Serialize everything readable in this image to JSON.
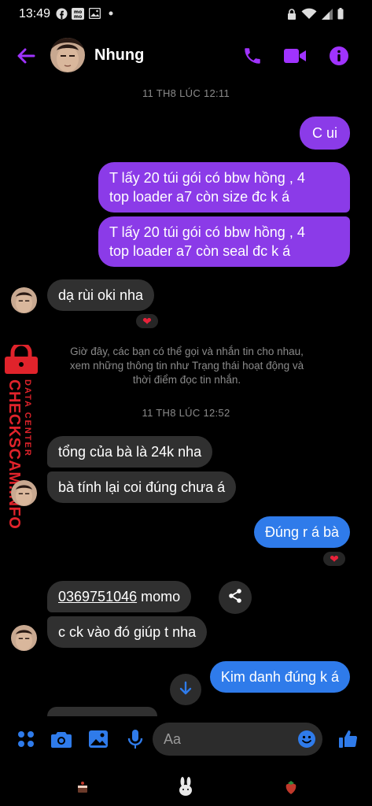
{
  "status_bar": {
    "time": "13:49",
    "left_icons": [
      "facebook-icon",
      "momo-icon",
      "gallery-icon",
      "dot"
    ],
    "right_icons": [
      "lock-icon",
      "wifi-icon",
      "signal-icon",
      "battery-icon"
    ]
  },
  "header": {
    "contact_name": "Nhung",
    "accent_color": "#a033ff"
  },
  "conversation": {
    "timestamp_1": "11 TH8 LÚC 12:11",
    "msg_1": "C ui",
    "msg_2_line1": "T lấy 20 túi gói có bbw hồng , 4",
    "msg_2_line2": "top loader a7 còn size đc k á",
    "msg_3_line1": "T lấy 20 túi gói có bbw hồng , 4",
    "msg_3_line2": "top loader a7 còn seal đc k á",
    "msg_4": "dạ rùi oki nha",
    "system_line1": "Giờ đây, các bạn có thể gọi và nhắn tin cho nhau,",
    "system_line2": "xem những thông tin như Trạng thái hoạt động và",
    "system_line3": "thời điểm đọc tin nhắn.",
    "timestamp_2": "11 TH8 LÚC 12:52",
    "msg_5": "tổng của bà là 24k nha",
    "msg_6": "bà tính lại coi đúng chưa á",
    "msg_7": "Đúng r á bà",
    "msg_8_phone": "0369751046",
    "msg_8_suffix": " momo",
    "msg_9": "c ck vào đó giúp t nha",
    "msg_10": "Kim danh đúng k á",
    "reaction": "❤"
  },
  "watermark": {
    "line1": "DATA CENTER",
    "line2": "CHECKSCAM.INFO"
  },
  "composer": {
    "placeholder": "Aa"
  },
  "colors": {
    "outgoing_purple": "#8b3be8",
    "outgoing_blue": "#2f7bea",
    "incoming": "#303030",
    "icon_blue": "#2f7bea",
    "watermark_red": "#e0232b"
  }
}
